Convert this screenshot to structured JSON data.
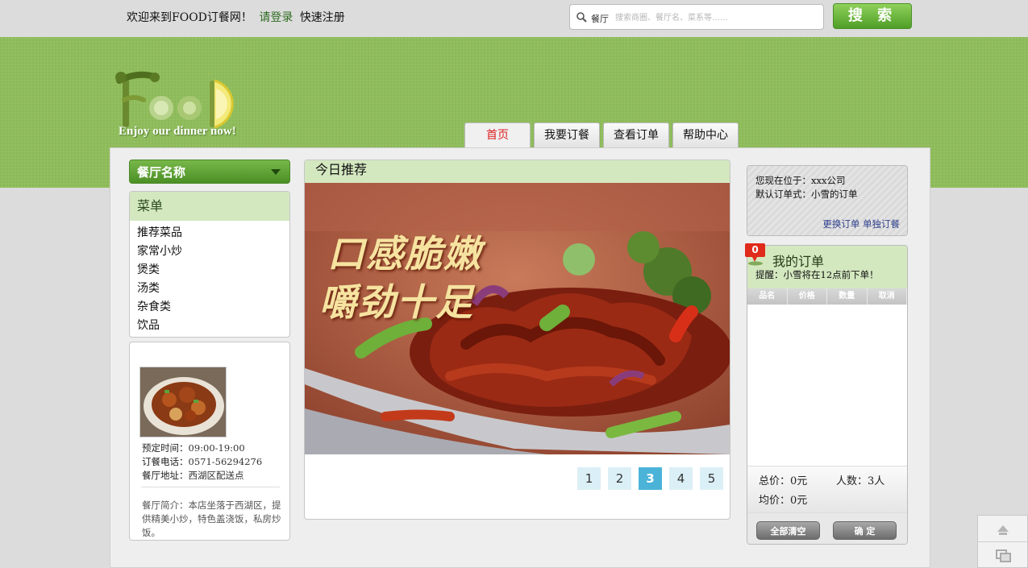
{
  "topbar": {
    "welcome": "欢迎来到FOOD订餐网！",
    "login": "请登录",
    "register": "快速注册",
    "search_category": "餐厅",
    "search_placeholder": "搜索商圈、餐厅名、菜系等……",
    "search_button": "搜 索"
  },
  "header": {
    "logo_letters": "FOOD",
    "logo_tagline": "Enjoy our dinner now!"
  },
  "nav": {
    "tabs": [
      {
        "label": "首页",
        "active": true
      },
      {
        "label": "我要订餐",
        "active": false
      },
      {
        "label": "查看订单",
        "active": false
      },
      {
        "label": "帮助中心",
        "active": false
      }
    ]
  },
  "sidebar": {
    "restaurant_select": "餐厅名称",
    "menu_title": "菜单",
    "menu_items": [
      "推荐菜品",
      "家常小炒",
      "煲类",
      "汤类",
      "杂食类",
      "饮品"
    ],
    "info": {
      "hours_label": "预定时间：",
      "hours": "09:00-19:00",
      "phone_label": "订餐电话：",
      "phone": "0571-56294276",
      "address_label": "餐厅地址：",
      "address": "西湖区配送点",
      "intro_label": "餐厅简介：",
      "intro": "本店坐落于西湖区，提供精美小炒，特色盖浇饭，私房炒饭。"
    }
  },
  "today": {
    "title": "今日推荐",
    "slogan_line1": "口感脆嫩",
    "slogan_line2": "嚼劲十足",
    "pages": [
      "1",
      "2",
      "3",
      "4",
      "5"
    ],
    "active_page": "3"
  },
  "location": {
    "line1": "您现在位于：xxx公司",
    "line2": "默认订单式：小雪的订单",
    "links": "更换订单 单独订餐"
  },
  "order": {
    "badge_count": "0",
    "title": "我的订单",
    "remind": "提醒：小雪将在12点前下单！",
    "columns": [
      "品名",
      "价格",
      "数量",
      "取消"
    ],
    "total": "总价：0元",
    "people": "人数：3人",
    "average": "均价：0元",
    "clear_button": "全部清空",
    "confirm_button": "确 定"
  },
  "colors": {
    "brand_green": "#8fbe5b",
    "panel_green": "#d4e8c0",
    "active_tab_text": "#dd2222",
    "pager_active": "#4bb3d8"
  }
}
